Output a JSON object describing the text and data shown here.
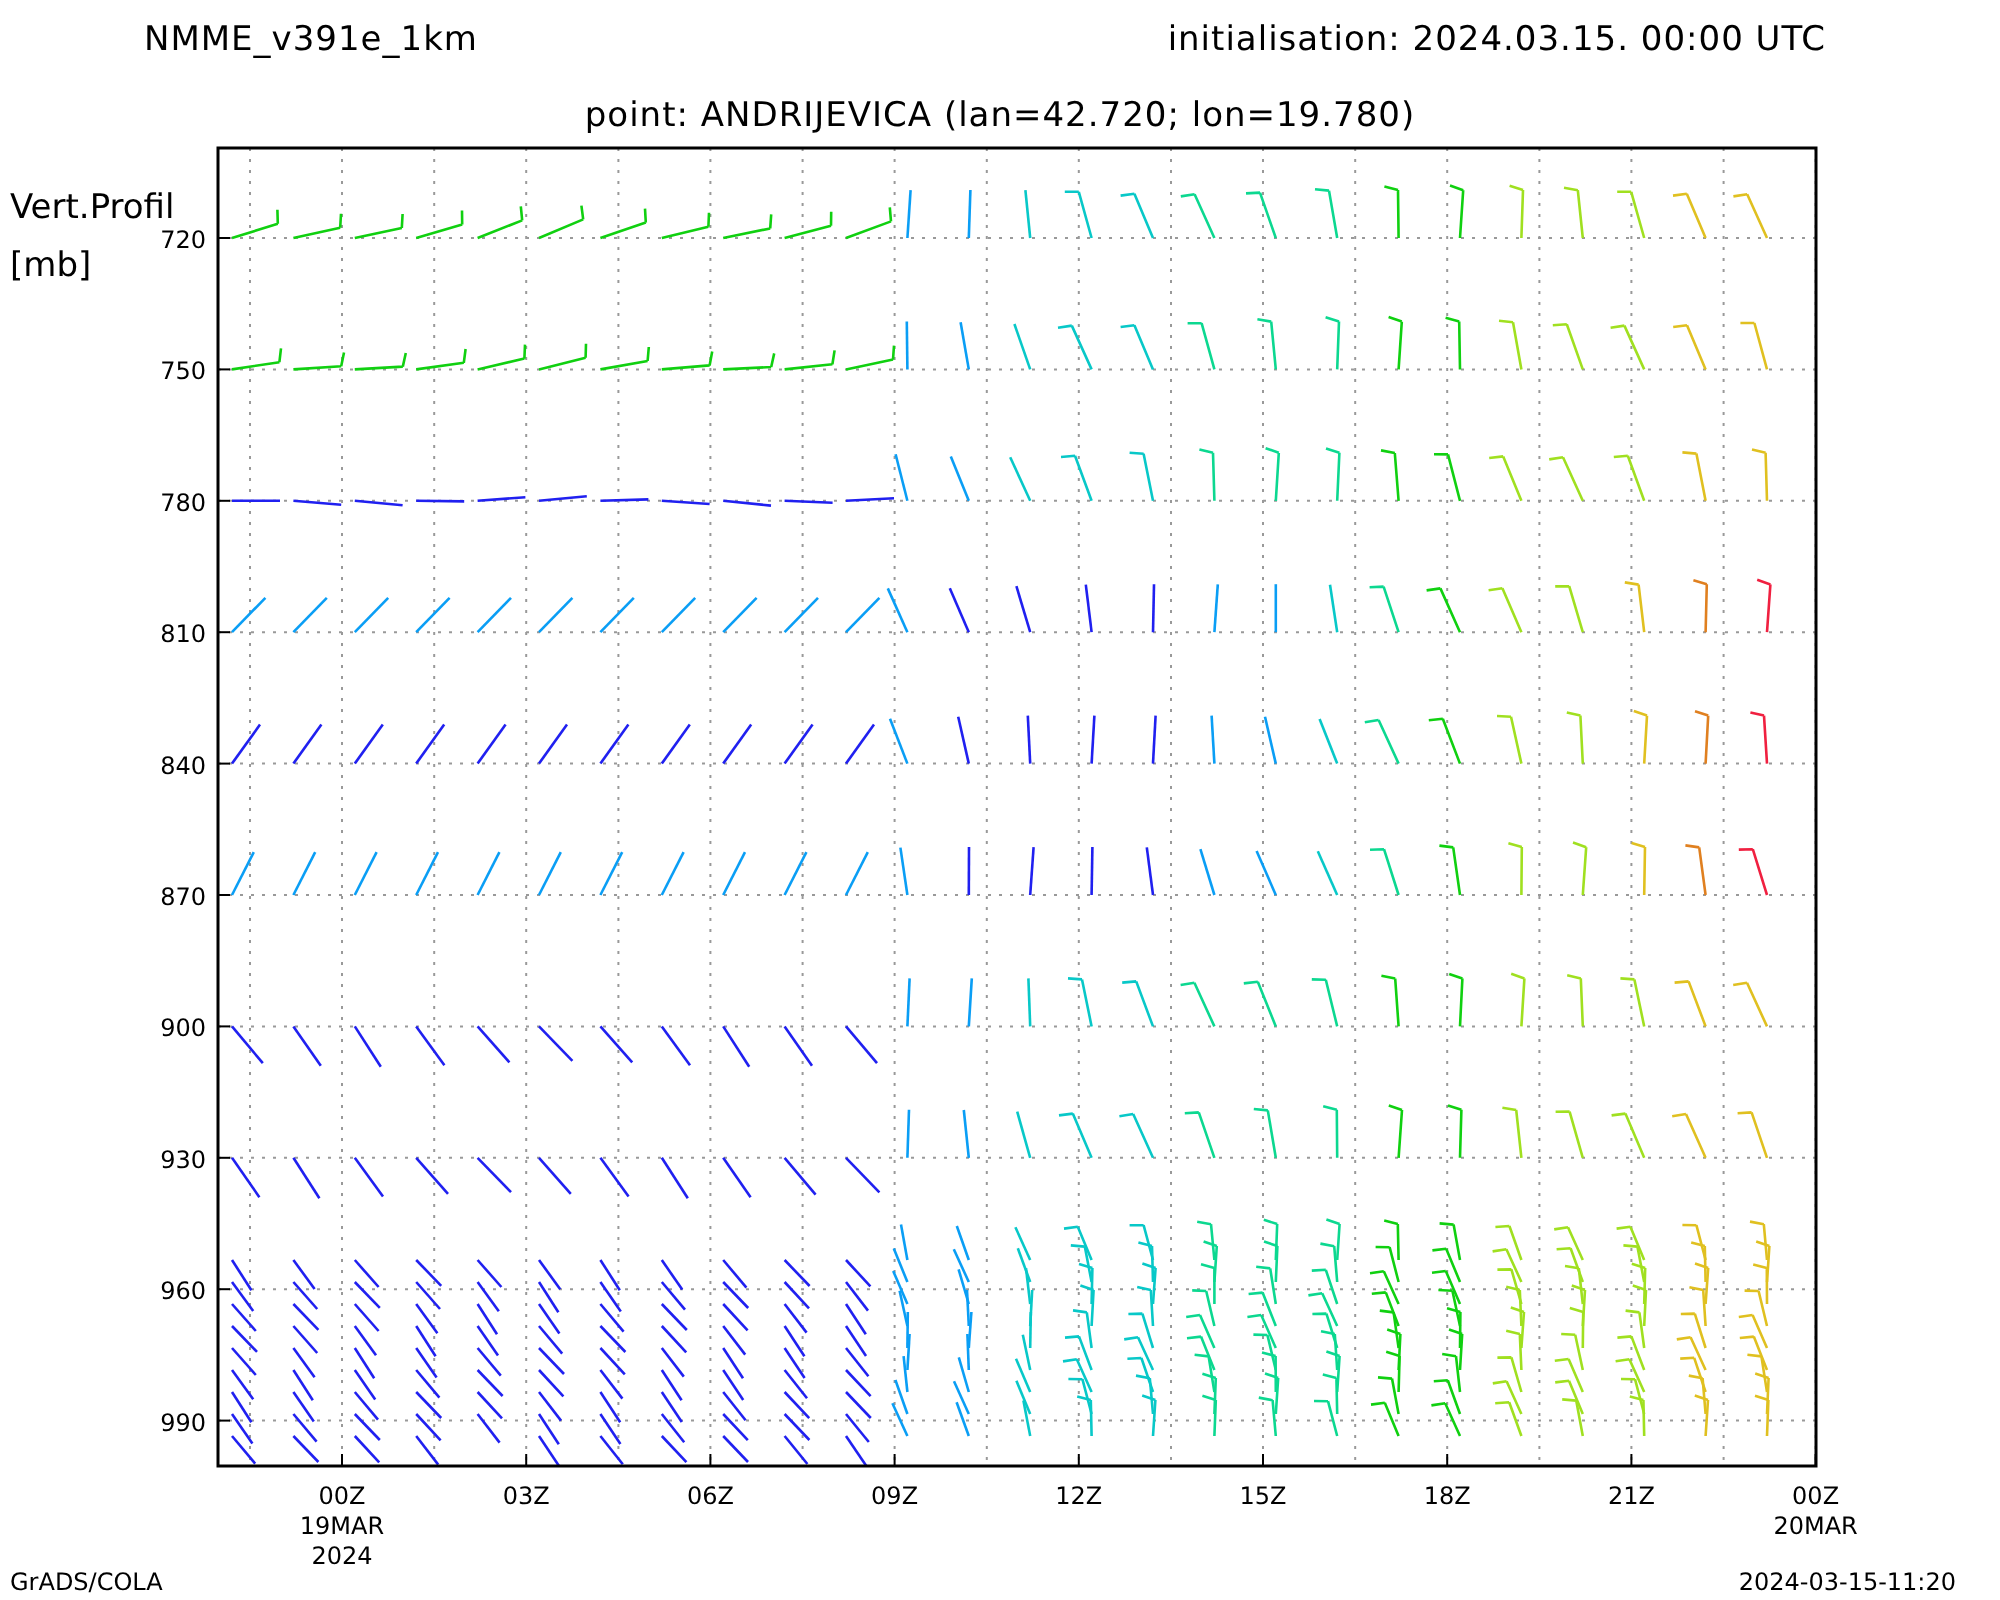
{
  "header": {
    "model": "NMME_v391e_1km",
    "initialisation": "initialisation: 2024.03.15. 00:00 UTC",
    "point": "point: ANDRIJEVICA (lan=42.720; lon=19.780)"
  },
  "plot": {
    "y_axis_title": [
      "Vert.Profil",
      "[mb]"
    ],
    "y_tick_labels": [
      "720",
      "750",
      "780",
      "810",
      "840",
      "870",
      "900",
      "930",
      "960",
      "990"
    ],
    "x_tick_labels": [
      {
        "lines": [
          "00Z",
          "19MAR",
          "2024"
        ]
      },
      {
        "lines": [
          "03Z"
        ]
      },
      {
        "lines": [
          "06Z"
        ]
      },
      {
        "lines": [
          "09Z"
        ]
      },
      {
        "lines": [
          "12Z"
        ]
      },
      {
        "lines": [
          "15Z"
        ]
      },
      {
        "lines": [
          "18Z"
        ]
      },
      {
        "lines": [
          "21Z"
        ]
      },
      {
        "lines": [
          "00Z",
          "20MAR"
        ]
      }
    ]
  },
  "footer": {
    "left": "GrADS/COLA",
    "right": "2024-03-15-11:20"
  }
}
